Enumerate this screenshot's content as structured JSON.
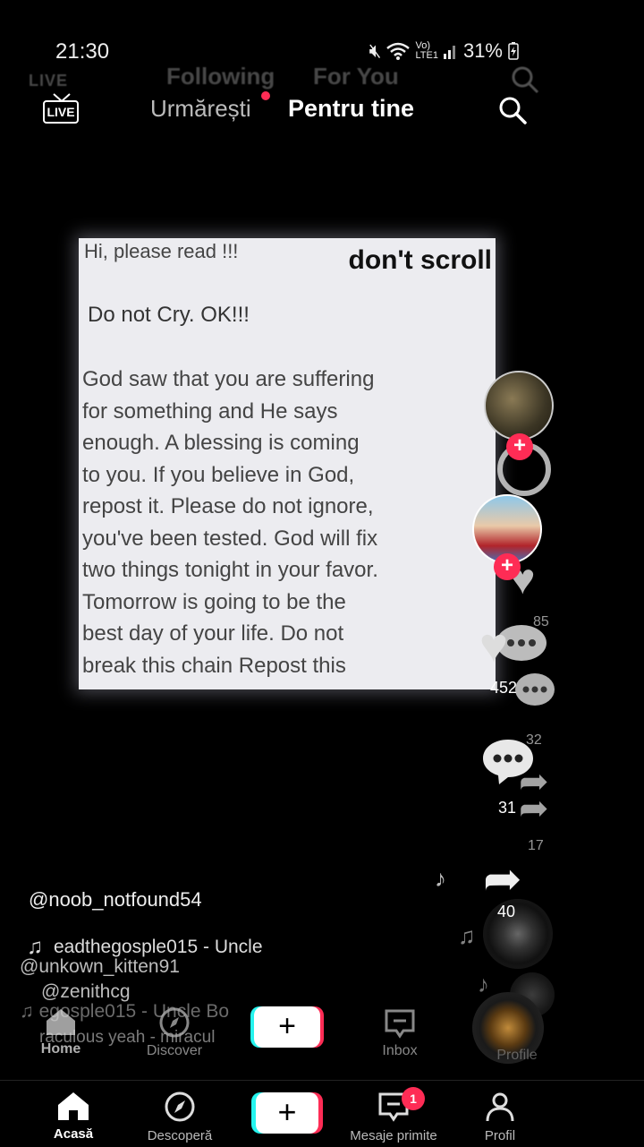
{
  "status_bar": {
    "time": "21:30",
    "network_top": "Vo)",
    "network_bottom": "LTE1",
    "battery": "31%"
  },
  "ghost_top": {
    "live": "LIVE",
    "following": "Following",
    "for_you": "For You"
  },
  "top_nav": {
    "live": "LIVE",
    "following": "Urmărești",
    "for_you": "Pentru tine"
  },
  "video": {
    "header": "Hi, please read !!!",
    "overlay": "don't scroll",
    "line1": "Do not Cry. OK!!!",
    "body": "God saw that you are suffering\nfor something and He says\nenough. A blessing is coming\nto you. If you believe in God,\nrepost it. Please do not ignore,\nyou've been tested. God will fix\ntwo things tonight in your favor.\nTomorrow is going to be the\nbest day of your life. Do not\nbreak this chain Repost this"
  },
  "right_rail": {
    "ghost_like": "85",
    "like_count": "452",
    "ghost_comment": "32",
    "comment_count": "31",
    "ghost_share": "17",
    "share_count": "40"
  },
  "caption": {
    "username": "@noob_notfound54",
    "music": "eadthegosple015 - Uncle",
    "ghost_user2": "@unkown_kitten91",
    "ghost_user3": "@zenithcg",
    "ghost_music2": "egosple015 - Uncle Bo",
    "ghost_miracle": "raculous  yeah - miracul"
  },
  "ghost_nav": {
    "home": "Home",
    "discover": "Discover",
    "plus": "+",
    "inbox": "Inbox",
    "profile": "Profile"
  },
  "bottom_nav": {
    "home": "Acasă",
    "discover": "Descoperă",
    "plus": "+",
    "inbox": "Mesaje primite",
    "inbox_badge": "1",
    "profile": "Profil"
  },
  "colors": {
    "accent": "#fe2c55",
    "cyan": "#25f4ee",
    "background": "#000000"
  }
}
